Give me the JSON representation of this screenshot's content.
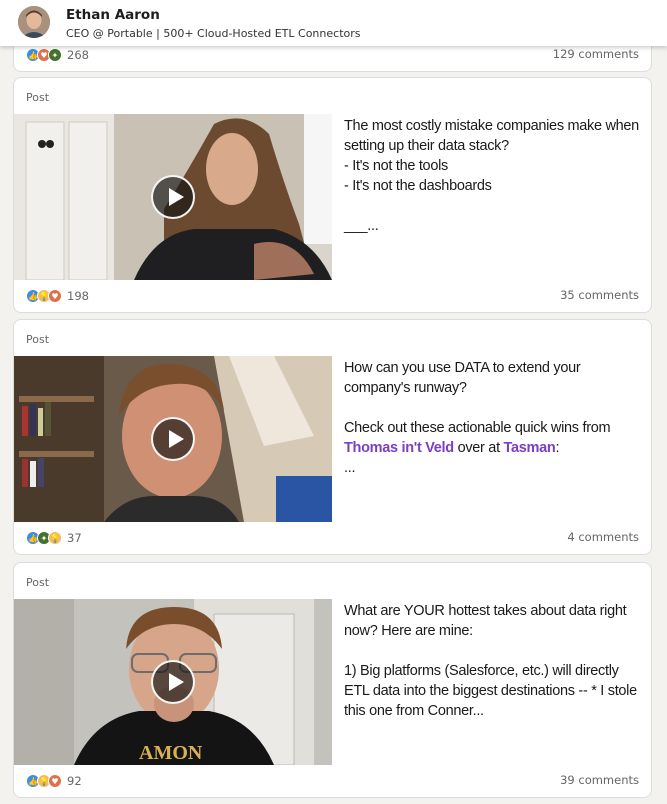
{
  "header": {
    "name": "Ethan Aaron",
    "title": "CEO @ Portable | 500+ Cloud-Hosted ETL Connectors"
  },
  "top_card": {
    "reaction_count": "268",
    "comments": "129 comments",
    "reactions": [
      "like",
      "love",
      "celebrate"
    ]
  },
  "posts": [
    {
      "label": "Post",
      "text_before": "The most costly mistake companies make when setting up their data stack?\n- It's not the tools\n- It's not the dashboards\n\n___...",
      "reaction_count": "198",
      "comments": "35 comments",
      "reactions": [
        "like",
        "insight",
        "love"
      ]
    },
    {
      "label": "Post",
      "text_before": "How can you use DATA to extend your company's runway?\n\nCheck out these actionable quick wins from ",
      "mention1": "Thomas in't Veld",
      "text_mid": " over at ",
      "mention2": "Tasman",
      "text_after": ":\n...",
      "reaction_count": "37",
      "comments": "4 comments",
      "reactions": [
        "like",
        "celebrate",
        "insight"
      ]
    },
    {
      "label": "Post",
      "text_before": "What are YOUR hottest takes about data right now? Here are mine:\n\n1) Big platforms (Salesforce, etc.) will directly ETL data into the biggest destinations -- * I stole this one from Conner...",
      "reaction_count": "92",
      "comments": "39 comments",
      "reactions": [
        "like",
        "insight",
        "love"
      ]
    }
  ],
  "icons": {
    "play": "play-icon",
    "like": "like-icon",
    "love": "love-icon",
    "celebrate": "celebrate-icon",
    "insight": "insight-icon"
  },
  "colors": {
    "mention": "#7a3fc4",
    "like": "#378fe9",
    "love": "#df704d",
    "celebrate": "#44712e",
    "insight": "#f5bb5c"
  }
}
